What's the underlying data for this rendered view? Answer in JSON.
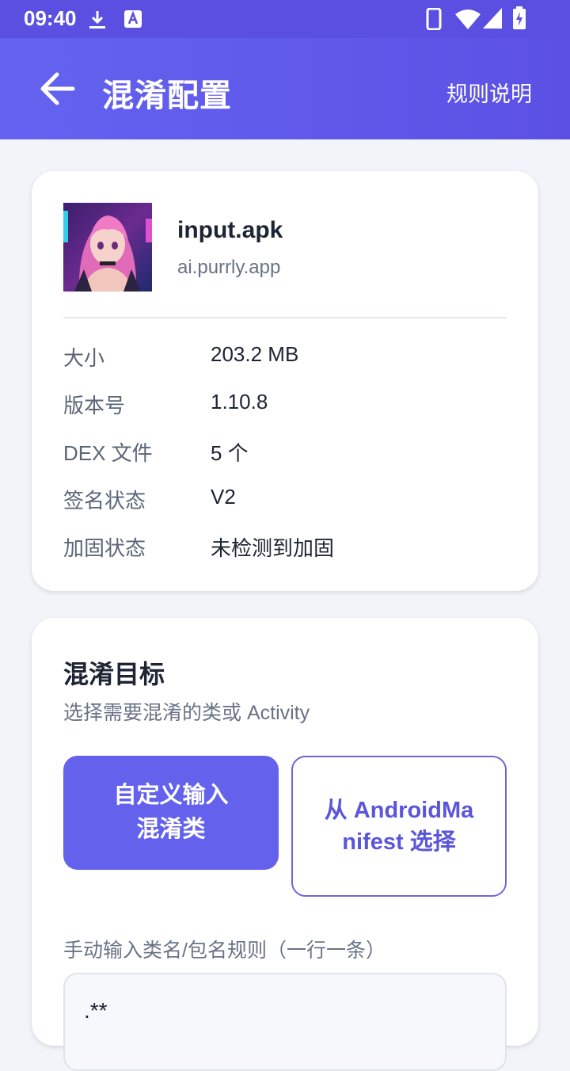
{
  "status": {
    "time": "09:40"
  },
  "appbar": {
    "title": "混淆配置",
    "rules_link": "规则说明"
  },
  "apk": {
    "file_name": "input.apk",
    "package": "ai.purrly.app",
    "info": [
      {
        "label": "大小",
        "value": "203.2 MB"
      },
      {
        "label": "版本号",
        "value": "1.10.8"
      },
      {
        "label": "DEX 文件",
        "value": "5 个"
      },
      {
        "label": "签名状态",
        "value": "V2"
      },
      {
        "label": "加固状态",
        "value": "未检测到加固"
      }
    ]
  },
  "target": {
    "title": "混淆目标",
    "subtitle": "选择需要混淆的类或 Activity",
    "custom_button": "自定义输入混淆类",
    "manifest_button": "从 AndroidManifest 选择",
    "input_label": "手动输入类名/包名规则（一行一条）",
    "input_value": ".**"
  },
  "colors": {
    "accent": "#6462ec",
    "appbar": "#5c50e4"
  }
}
